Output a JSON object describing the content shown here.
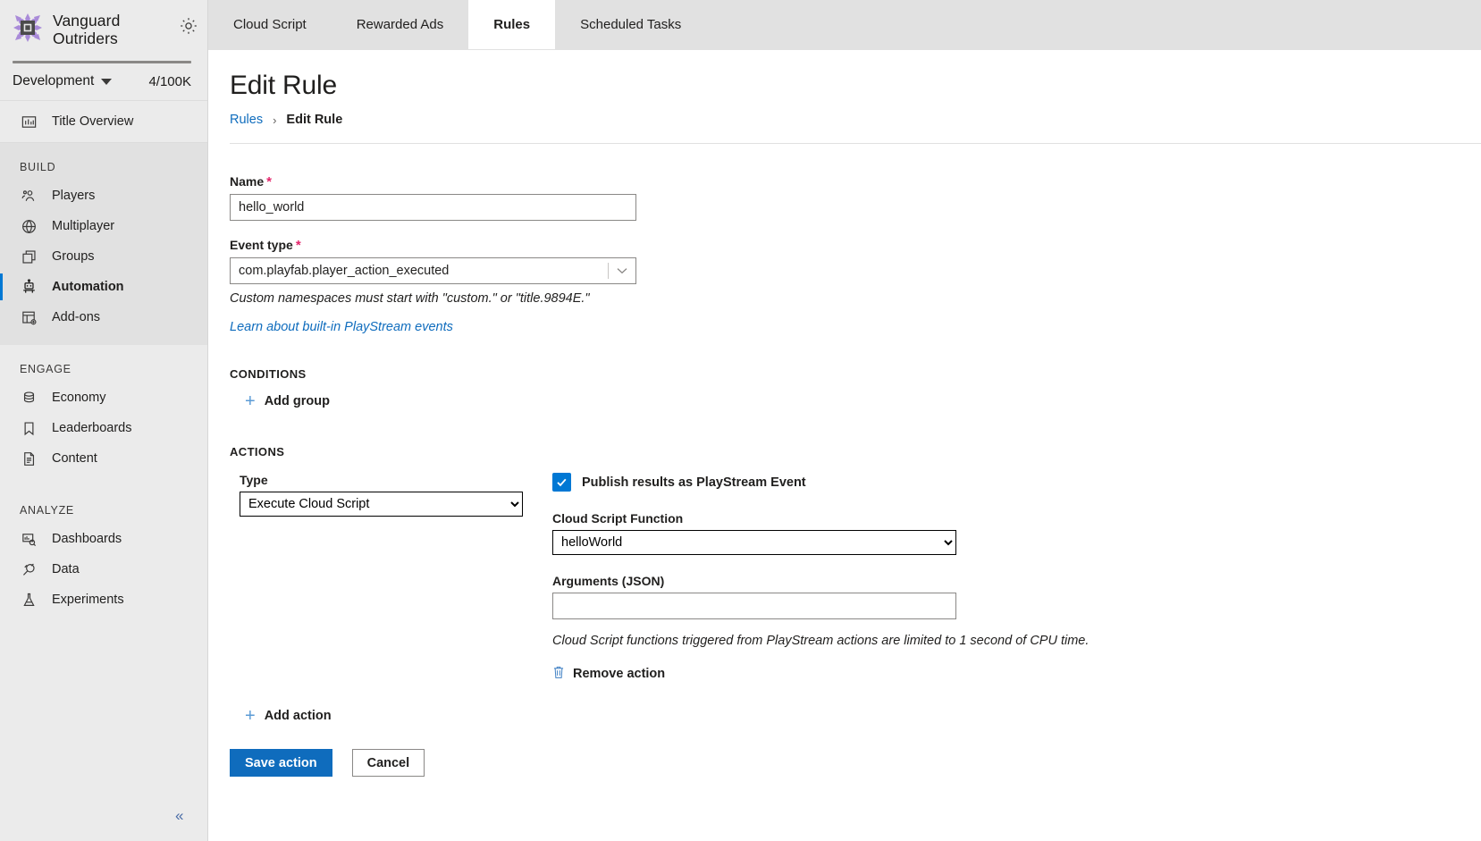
{
  "sidebar": {
    "brand": {
      "title": "Vanguard\nOutriders",
      "logo_icon": "pixel-burst-logo",
      "settings_icon": "gear-icon"
    },
    "environment": {
      "name": "Development",
      "count": "4/100K",
      "chevron_icon": "chevron-down-icon"
    },
    "overview": {
      "label": "Title Overview",
      "icon": "bar-chart-icon"
    },
    "sections": [
      {
        "label": "BUILD",
        "items": [
          {
            "label": "Players",
            "icon": "players-icon",
            "selected": false
          },
          {
            "label": "Multiplayer",
            "icon": "globe-icon",
            "selected": false
          },
          {
            "label": "Groups",
            "icon": "stacked-squares-icon",
            "selected": false
          },
          {
            "label": "Automation",
            "icon": "robot-icon",
            "selected": true
          },
          {
            "label": "Add-ons",
            "icon": "addons-grid-icon",
            "selected": false
          }
        ]
      },
      {
        "label": "ENGAGE",
        "items": [
          {
            "label": "Economy",
            "icon": "database-coins-icon",
            "selected": false
          },
          {
            "label": "Leaderboards",
            "icon": "bookmark-icon",
            "selected": false
          },
          {
            "label": "Content",
            "icon": "document-icon",
            "selected": false
          }
        ]
      },
      {
        "label": "ANALYZE",
        "items": [
          {
            "label": "Dashboards",
            "icon": "dashboard-magnifier-icon",
            "selected": false
          },
          {
            "label": "Data",
            "icon": "plug-icon",
            "selected": false
          },
          {
            "label": "Experiments",
            "icon": "flask-icon",
            "selected": false
          }
        ]
      }
    ],
    "collapse": {
      "glyph": "«",
      "icon": "collapse-sidebar-icon"
    }
  },
  "tabs": [
    {
      "label": "Cloud Script",
      "active": false
    },
    {
      "label": "Rewarded Ads",
      "active": false
    },
    {
      "label": "Rules",
      "active": true
    },
    {
      "label": "Scheduled Tasks",
      "active": false
    }
  ],
  "page": {
    "title": "Edit Rule",
    "breadcrumb": {
      "parent": "Rules",
      "separator": "›",
      "current": "Edit Rule"
    }
  },
  "form": {
    "name": {
      "label": "Name",
      "required_mark": "*",
      "value": "hello_world",
      "placeholder": ""
    },
    "event_type": {
      "label": "Event type",
      "required_mark": "*",
      "value": "com.playfab.player_action_executed",
      "caret_icon": "chevron-down-icon",
      "hint": "Custom namespaces must start with \"custom.\" or \"title.9894E.\"",
      "learn_link": "Learn about built-in PlayStream events"
    }
  },
  "conditions": {
    "heading": "CONDITIONS",
    "add_group": {
      "label": "Add group",
      "icon": "plus-icon"
    }
  },
  "actions": {
    "heading": "ACTIONS",
    "type": {
      "label": "Type",
      "value": "Execute Cloud Script",
      "options": [
        "Execute Cloud Script"
      ]
    },
    "publish_checkbox": {
      "label": "Publish results as PlayStream Event",
      "checked": true,
      "icon": "checkmark-icon"
    },
    "cloud_script_function": {
      "label": "Cloud Script Function",
      "value": "helloWorld",
      "options": [
        "helloWorld"
      ]
    },
    "arguments": {
      "label": "Arguments (JSON)",
      "value": "",
      "placeholder": ""
    },
    "cpu_hint": "Cloud Script functions triggered from PlayStream actions are limited to 1 second of CPU time.",
    "remove_action": {
      "label": "Remove action",
      "icon": "trash-icon"
    },
    "add_action": {
      "label": "Add action",
      "icon": "plus-icon"
    }
  },
  "footer": {
    "save": "Save action",
    "cancel": "Cancel"
  },
  "colors": {
    "accent_blue": "#0078d4",
    "link_blue": "#0f6cbd",
    "required_red": "#e3256b",
    "sidebar_bg": "#ebebeb",
    "sidebar_block_bg": "#e1e1e1",
    "logo_purple": "#a98bd8"
  }
}
